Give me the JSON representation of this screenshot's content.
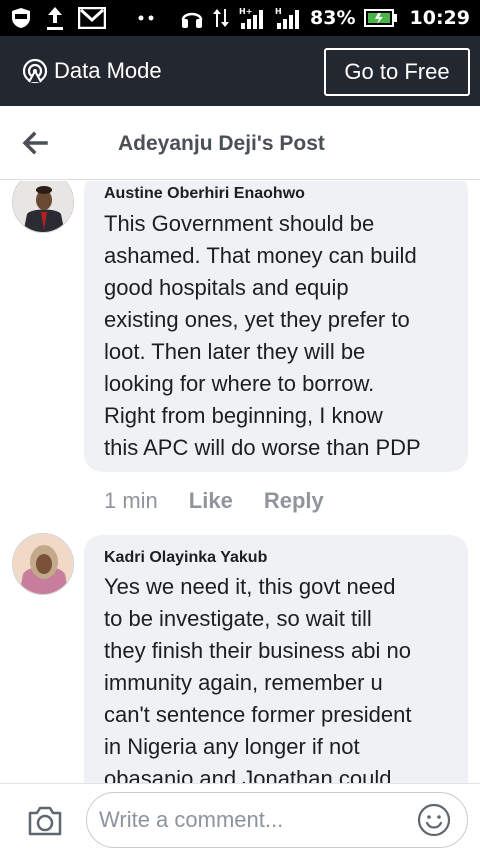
{
  "status_bar": {
    "battery": "83%",
    "time": "10:29",
    "icons": [
      "shield-icon",
      "upload-icon",
      "gmail-icon",
      "more-dots-icon",
      "headphones-icon",
      "data-transfer-icon",
      "signal-icon",
      "signal-icon",
      "battery-icon"
    ]
  },
  "data_mode": {
    "label": "Data Mode",
    "button": "Go to Free"
  },
  "header": {
    "title": "Adeyanju Deji's Post"
  },
  "comments": [
    {
      "author": "Austine Oberhiri Enaohwo",
      "lines": [
        "This Government should be",
        "ashamed. That money can build",
        "good hospitals and equip",
        "existing ones, yet they prefer to",
        "loot. Then later they will be",
        "looking for where to borrow.",
        "Right from beginning, I know",
        "this APC will do worse than PDP"
      ],
      "time": "1 min",
      "like": "Like",
      "reply": "Reply"
    },
    {
      "author": "Kadri Olayinka Yakub",
      "lines": [
        "Yes we need it, this govt need",
        "to be investigate, so wait till",
        "they finish their business abi no",
        "immunity again, remember u",
        "can't sentence former president",
        "in Nigeria any longer if not",
        "obasanjo and Jonathan could"
      ]
    }
  ],
  "composer": {
    "placeholder": "Write a comment..."
  },
  "colors": {
    "data_bar": "#23272f",
    "bubble": "#f0f1f4",
    "muted_text": "#90949c"
  }
}
